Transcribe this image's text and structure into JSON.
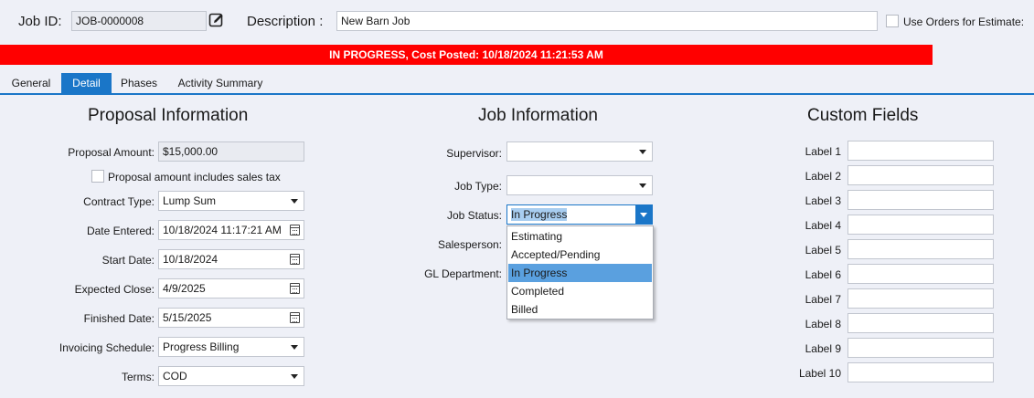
{
  "header": {
    "job_id_label": "Job ID:",
    "job_id_value": "JOB-0000008",
    "description_label": "Description :",
    "description_value": "New Barn Job",
    "use_orders_label": "Use Orders for Estimate:",
    "use_orders_checked": false
  },
  "status_banner": {
    "text": "IN PROGRESS, Cost Posted: 10/18/2024 11:21:53 AM",
    "color": "#ff0000"
  },
  "tabs": [
    {
      "label": "General",
      "active": false
    },
    {
      "label": "Detail",
      "active": true
    },
    {
      "label": "Phases",
      "active": false
    },
    {
      "label": "Activity Summary",
      "active": false
    }
  ],
  "proposal": {
    "title": "Proposal Information",
    "amount_label": "Proposal Amount:",
    "amount_value": "$15,000.00",
    "includes_tax_label": "Proposal amount includes sales tax",
    "contract_type_label": "Contract Type:",
    "contract_type_value": "Lump Sum",
    "date_entered_label": "Date Entered:",
    "date_entered_value": "10/18/2024 11:17:21 AM",
    "start_date_label": "Start Date:",
    "start_date_value": "10/18/2024",
    "expected_close_label": "Expected Close:",
    "expected_close_value": "4/9/2025",
    "finished_date_label": "Finished Date:",
    "finished_date_value": "5/15/2025",
    "invoicing_label": "Invoicing Schedule:",
    "invoicing_value": "Progress Billing",
    "terms_label": "Terms:",
    "terms_value": "COD"
  },
  "job_info": {
    "title": "Job Information",
    "supervisor_label": "Supervisor:",
    "supervisor_value": "",
    "job_type_label": "Job Type:",
    "job_type_value": "",
    "job_status_label": "Job Status:",
    "job_status_value": "In Progress",
    "salesperson_label": "Salesperson:",
    "gl_department_label": "GL Department:",
    "status_options": [
      "Estimating",
      "Accepted/Pending",
      "In Progress",
      "Completed",
      "Billed"
    ],
    "selected_option": "In Progress"
  },
  "custom_fields": {
    "title": "Custom Fields",
    "labels": [
      "Label 1",
      "Label 2",
      "Label 3",
      "Label 4",
      "Label 5",
      "Label 6",
      "Label 7",
      "Label 8",
      "Label 9",
      "Label 10"
    ]
  },
  "colors": {
    "accent": "#1a76c8",
    "background": "#eef0f7",
    "banner": "#ff0000",
    "dropdown_selected": "#5aa0df"
  },
  "icons": {
    "edit": "edit-icon",
    "calendar": "calendar-icon",
    "dropdown": "chevron-down-icon"
  }
}
